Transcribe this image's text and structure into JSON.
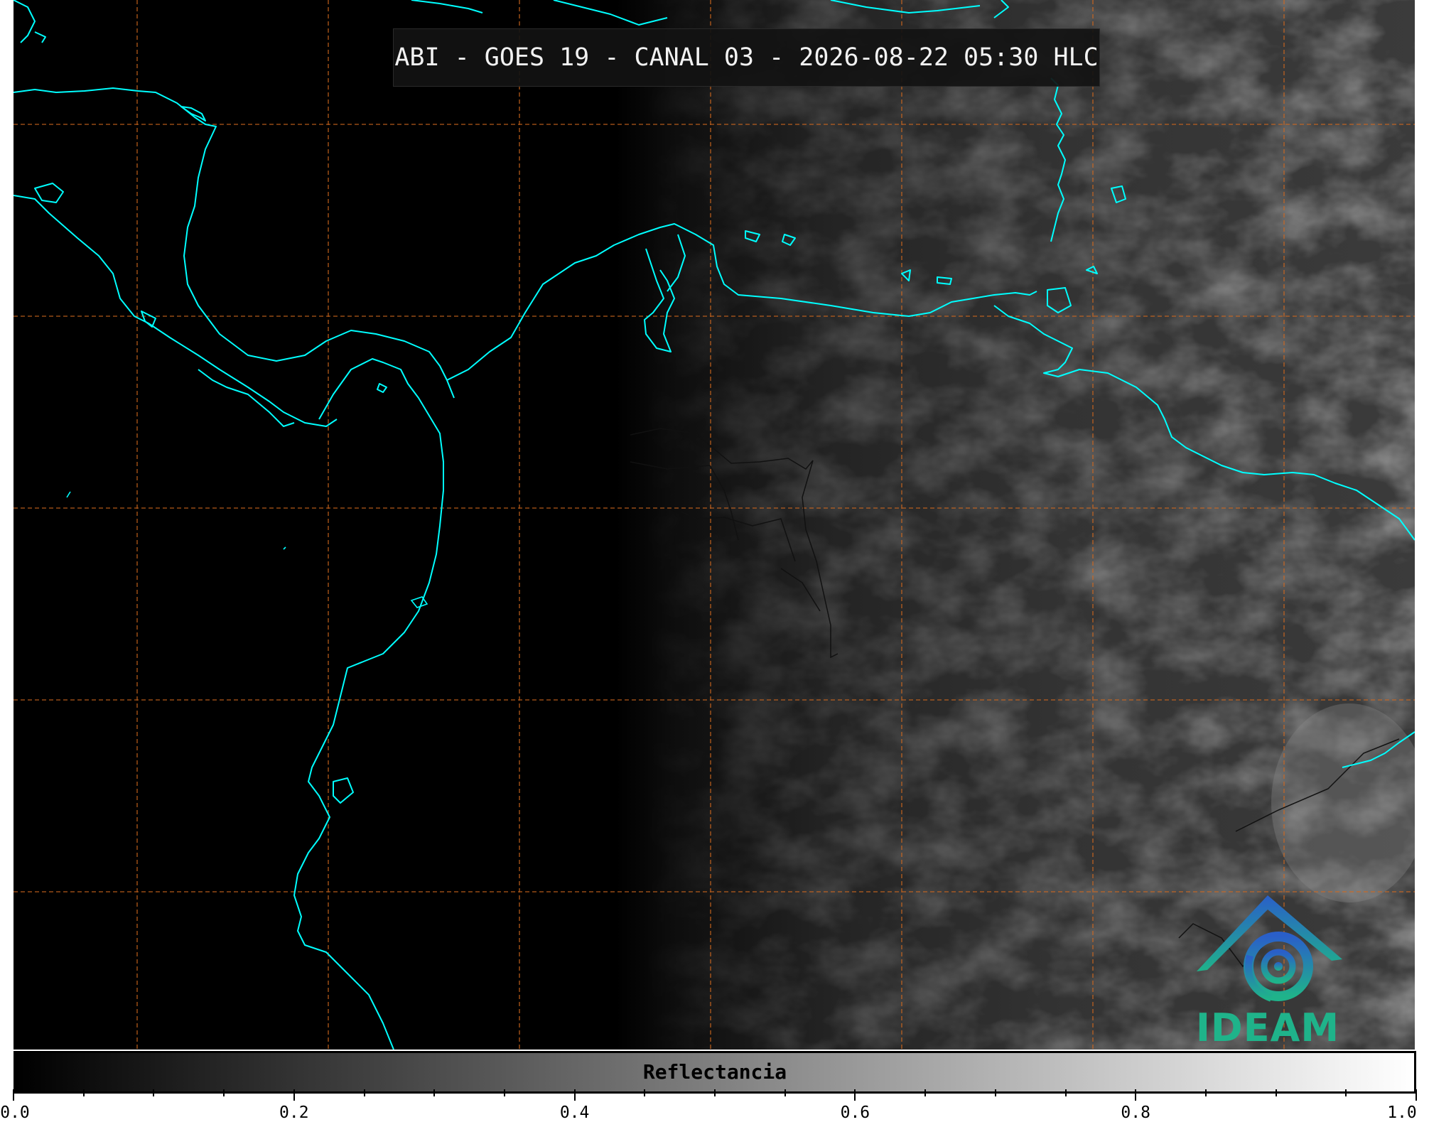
{
  "title": "ABI - GOES 19 - CANAL 03 - 2026-08-22 05:30 HLC",
  "logo": {
    "text": "IDEAM",
    "icon": "ideam-logo-icon"
  },
  "colorbar": {
    "label": "Reflectancia",
    "min": 0.0,
    "max": 1.0,
    "tick_labels": [
      "0.0",
      "0.2",
      "0.4",
      "0.6",
      "0.8",
      "1.0"
    ],
    "colormap": [
      "#000000",
      "#ffffff"
    ]
  },
  "colors": {
    "coastline": "#00ffff",
    "gridline": "#d2691e",
    "border": "#000000"
  },
  "map": {
    "grid": true,
    "grid_style": "dashed"
  }
}
